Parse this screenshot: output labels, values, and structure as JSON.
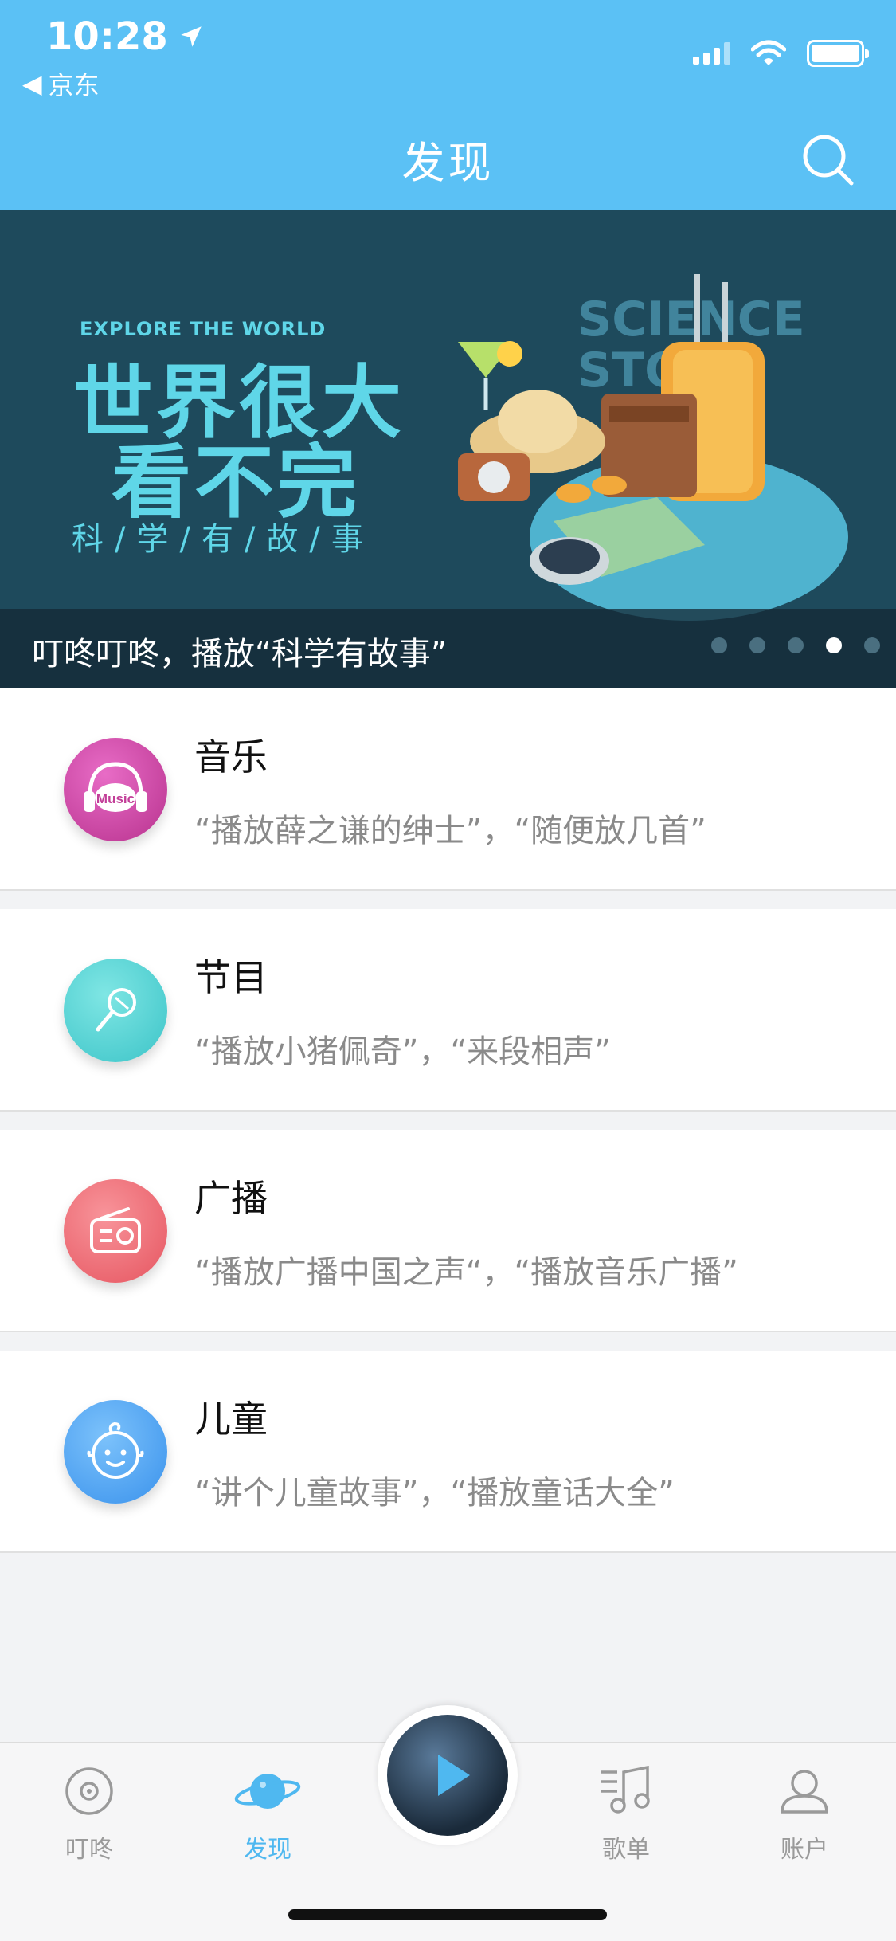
{
  "status": {
    "time": "10:28",
    "back_app": "京东"
  },
  "header": {
    "title": "发现"
  },
  "banner": {
    "en_line": "EXPLORE THE WORLD",
    "cn_line1": "世界很大",
    "cn_line2": "看不完",
    "sub_line": "科/学/有/故/事",
    "science_line1": "SCIENCE",
    "science_line2": "STORY",
    "caption": "叮咚叮咚，播放“科学有故事”",
    "dots_total": 5,
    "dots_active_index": 3
  },
  "categories": [
    {
      "title": "音乐",
      "desc": "“播放薛之谦的绅士”，“随便放几首”",
      "icon": "music-icon",
      "color": "#d84fb0"
    },
    {
      "title": "节目",
      "desc": "“播放小猪佩奇”，“来段相声”",
      "icon": "microphone-icon",
      "color": "#55d6d6"
    },
    {
      "title": "广播",
      "desc": "“播放广播中国之声“，“播放音乐广播”",
      "icon": "radio-icon",
      "color": "#f06d78"
    },
    {
      "title": "儿童",
      "desc": "“讲个儿童故事”，“播放童话大全”",
      "icon": "baby-face-icon",
      "color": "#4aa8f5"
    }
  ],
  "tabs": [
    {
      "label": "叮咚",
      "icon": "disc-icon",
      "active": false
    },
    {
      "label": "发现",
      "icon": "planet-icon",
      "active": true
    },
    {
      "label": "歌单",
      "icon": "music-list-icon",
      "active": false
    },
    {
      "label": "账户",
      "icon": "user-icon",
      "active": false
    }
  ],
  "colors": {
    "header_bg": "#5bc1f5",
    "tab_active": "#4fb8f0",
    "banner_bg": "#1e4a5c"
  }
}
